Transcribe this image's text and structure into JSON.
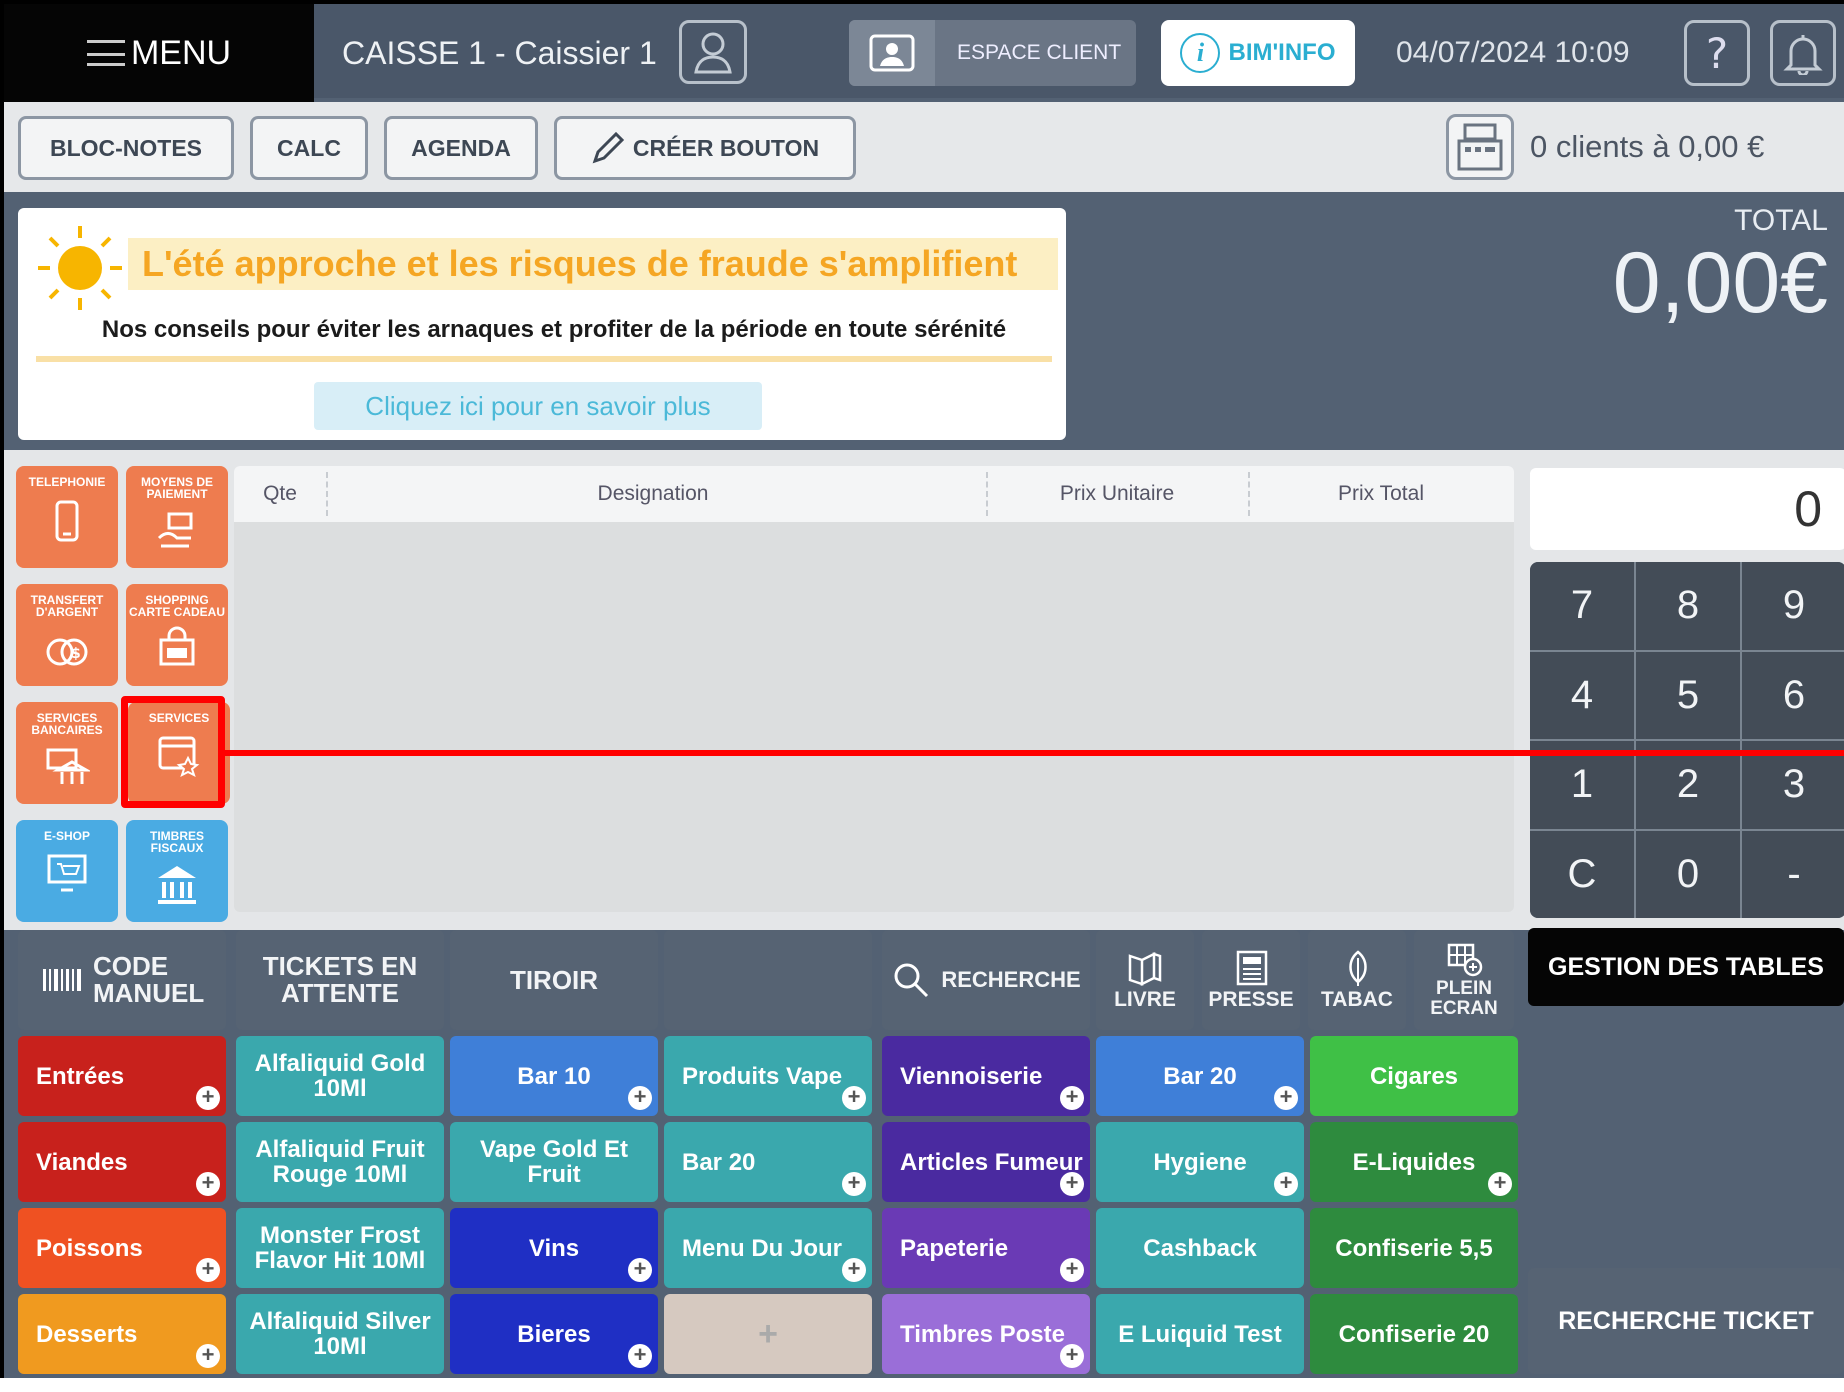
{
  "header": {
    "menu_label": "MENU",
    "caisse_label": "CAISSE 1 - Caissier 1",
    "espace_client": "ESPACE CLIENT",
    "bim_info": "BIM'INFO",
    "datetime": "04/07/2024 10:09",
    "help": "?"
  },
  "toolbar": {
    "bloc_notes": "BLOC-NOTES",
    "calc": "CALC",
    "agenda": "AGENDA",
    "creer_bouton": "CRÉER BOUTON",
    "clients_summary": "0 clients à 0,00 €"
  },
  "promo": {
    "title": "L'été approche et les risques de fraude s'amplifient",
    "subtitle": "Nos conseils pour éviter les arnaques et profiter de la période en toute sérénité",
    "link": "Cliquez ici pour en savoir plus"
  },
  "total": {
    "label": "TOTAL",
    "value": "0,00€"
  },
  "categories": [
    {
      "label": "TELEPHONIE",
      "icon": "phone-icon",
      "color": "#ee7c4f"
    },
    {
      "label": "MOYENS DE PAIEMENT",
      "icon": "payment-hand-icon",
      "color": "#ee7c4f"
    },
    {
      "label": "TRANSFERT D'ARGENT",
      "icon": "money-transfer-icon",
      "color": "#ee7c4f"
    },
    {
      "label": "SHOPPING CARTE CADEAU",
      "icon": "gift-card-bag-icon",
      "color": "#ee7c4f"
    },
    {
      "label": "SERVICES BANCAIRES",
      "icon": "bank-card-icon",
      "color": "#ee7c4f"
    },
    {
      "label": "SERVICES",
      "icon": "services-star-icon",
      "color": "#ee7c4f"
    },
    {
      "label": "E-SHOP",
      "icon": "eshop-cart-icon",
      "color": "#4aabe3"
    },
    {
      "label": "TIMBRES FISCAUX",
      "icon": "institution-icon",
      "color": "#4aabe3"
    }
  ],
  "ticket": {
    "columns": [
      "Qte",
      "Designation",
      "Prix Unitaire",
      "Prix Total"
    ]
  },
  "keypad": {
    "display": "0",
    "keys": [
      "7",
      "8",
      "9",
      "4",
      "5",
      "6",
      "1",
      "2",
      "3",
      "C",
      "0",
      "-"
    ]
  },
  "functions": {
    "code_manuel": "CODE MANUEL",
    "tickets_attente": "TICKETS EN ATTENTE",
    "tiroir": "TIROIR",
    "recherche": "RECHERCHE",
    "livre": "LIVRE",
    "presse": "PRESSE",
    "tabac": "TABAC",
    "plein_ecran": "PLEIN ECRAN"
  },
  "gestion_tables": "GESTION DES TABLES",
  "recherche_ticket": "RECHERCHE TICKET",
  "products": [
    [
      "Entrées",
      "Alfaliquid Gold 10Ml",
      "Bar 10",
      "Produits Vape",
      "Viennoiserie",
      "Bar 20",
      "Cigares"
    ],
    [
      "Viandes",
      "Alfaliquid Fruit Rouge 10Ml",
      "Vape Gold Et Fruit",
      "Bar 20",
      "Articles Fumeur",
      "Hygiene",
      "E-Liquides"
    ],
    [
      "Poissons",
      "Monster Frost Flavor Hit 10Ml",
      "Vins",
      "Menu Du Jour",
      "Papeterie",
      "Cashback",
      "Confiserie 5,5"
    ],
    [
      "Desserts",
      "Alfaliquid Silver 10Ml",
      "Bieres",
      "+",
      "Timbres Poste",
      "E Luiquid Test",
      "Confiserie 20"
    ]
  ],
  "colors": {
    "red": "#c8211c",
    "orange": "#ef5122",
    "amber": "#f09a1f",
    "teal": "#3aa8ad",
    "blue": "#3f7fd8",
    "navy": "#1f2fc4",
    "purple": "#4a2aa0",
    "violet": "#6a3ab5",
    "lavender": "#9a6ed8",
    "green": "#3fc046",
    "darkgreen": "#2e8b3e",
    "tan": "#d6c9c0"
  }
}
